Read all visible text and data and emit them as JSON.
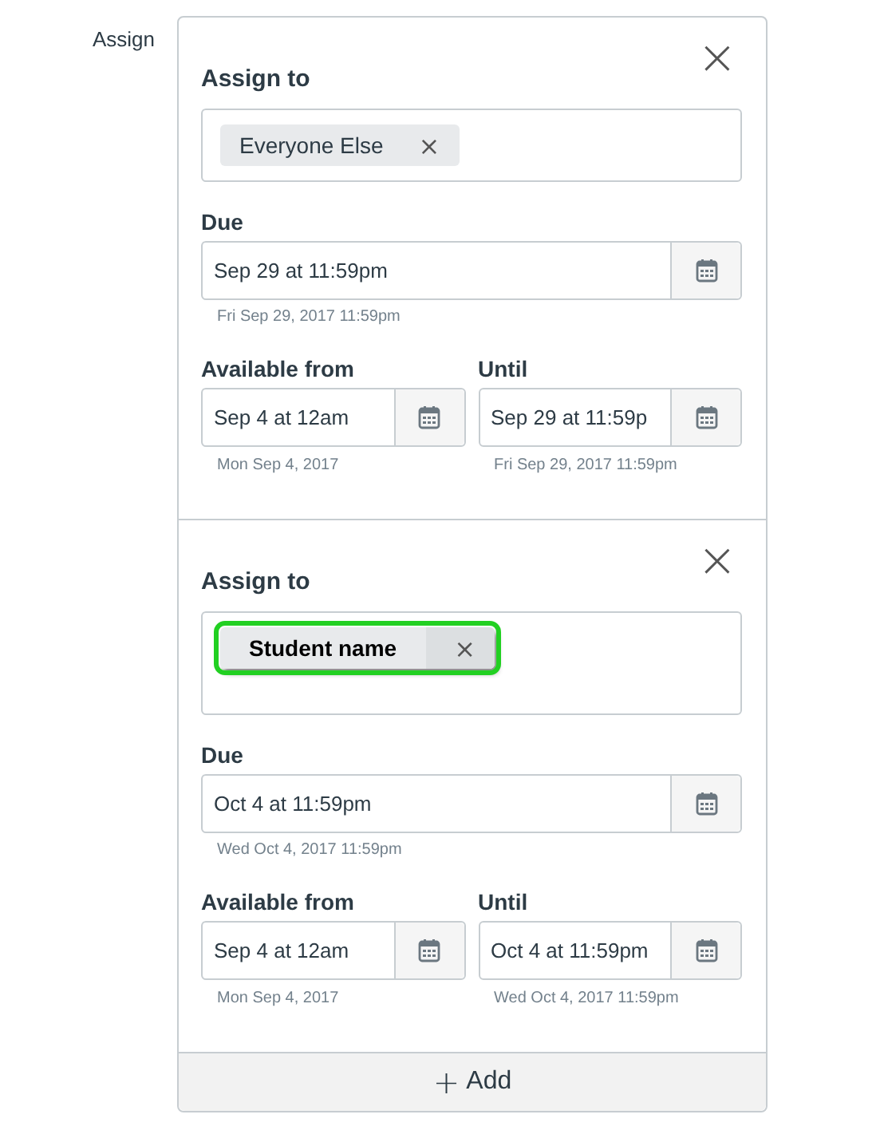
{
  "section_label": "Assign",
  "assignments": [
    {
      "close": "×",
      "assign_to_label": "Assign to",
      "assignees": [
        {
          "name": "Everyone Else",
          "remove": "×",
          "highlighted": false
        }
      ],
      "due": {
        "label": "Due",
        "value": "Sep 29 at 11:59pm",
        "hint": "Fri Sep 29, 2017 11:59pm"
      },
      "available_from": {
        "label": "Available from",
        "value": "Sep 4 at 12am",
        "hint": "Mon Sep 4, 2017"
      },
      "until": {
        "label": "Until",
        "value": "Sep 29 at 11:59p",
        "hint": "Fri Sep 29, 2017 11:59pm"
      }
    },
    {
      "close": "×",
      "assign_to_label": "Assign to",
      "assignees": [
        {
          "name": "Student name",
          "remove": "×",
          "highlighted": true
        }
      ],
      "due": {
        "label": "Due",
        "value": "Oct 4 at 11:59pm",
        "hint": "Wed Oct 4, 2017 11:59pm"
      },
      "available_from": {
        "label": "Available from",
        "value": "Sep 4 at 12am",
        "hint": "Mon Sep 4, 2017"
      },
      "until": {
        "label": "Until",
        "value": "Oct 4 at 11:59pm",
        "hint": "Wed Oct 4, 2017 11:59pm"
      }
    }
  ],
  "add_button": {
    "icon": "+",
    "label": "Add"
  }
}
